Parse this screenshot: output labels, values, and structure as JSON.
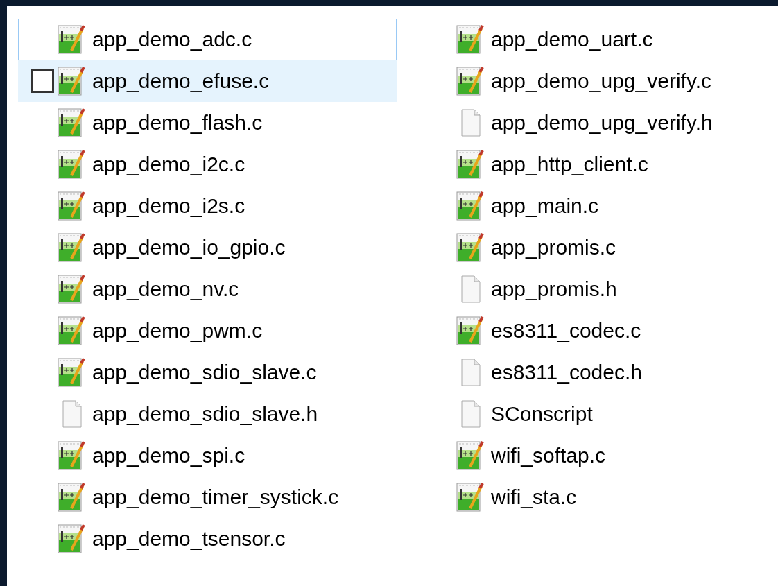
{
  "columns": [
    {
      "files": [
        {
          "name": "app_demo_adc.c",
          "kind": "source",
          "focused": true,
          "hovered": false
        },
        {
          "name": "app_demo_efuse.c",
          "kind": "source",
          "focused": false,
          "hovered": true
        },
        {
          "name": "app_demo_flash.c",
          "kind": "source",
          "focused": false,
          "hovered": false
        },
        {
          "name": "app_demo_i2c.c",
          "kind": "source",
          "focused": false,
          "hovered": false
        },
        {
          "name": "app_demo_i2s.c",
          "kind": "source",
          "focused": false,
          "hovered": false
        },
        {
          "name": "app_demo_io_gpio.c",
          "kind": "source",
          "focused": false,
          "hovered": false
        },
        {
          "name": "app_demo_nv.c",
          "kind": "source",
          "focused": false,
          "hovered": false
        },
        {
          "name": "app_demo_pwm.c",
          "kind": "source",
          "focused": false,
          "hovered": false
        },
        {
          "name": "app_demo_sdio_slave.c",
          "kind": "source",
          "focused": false,
          "hovered": false
        },
        {
          "name": "app_demo_sdio_slave.h",
          "kind": "blank",
          "focused": false,
          "hovered": false
        },
        {
          "name": "app_demo_spi.c",
          "kind": "source",
          "focused": false,
          "hovered": false
        },
        {
          "name": "app_demo_timer_systick.c",
          "kind": "source",
          "focused": false,
          "hovered": false
        },
        {
          "name": "app_demo_tsensor.c",
          "kind": "source",
          "focused": false,
          "hovered": false
        }
      ]
    },
    {
      "files": [
        {
          "name": "app_demo_uart.c",
          "kind": "source",
          "focused": false,
          "hovered": false
        },
        {
          "name": "app_demo_upg_verify.c",
          "kind": "source",
          "focused": false,
          "hovered": false
        },
        {
          "name": "app_demo_upg_verify.h",
          "kind": "blank",
          "focused": false,
          "hovered": false
        },
        {
          "name": "app_http_client.c",
          "kind": "source",
          "focused": false,
          "hovered": false
        },
        {
          "name": "app_main.c",
          "kind": "source",
          "focused": false,
          "hovered": false
        },
        {
          "name": "app_promis.c",
          "kind": "source",
          "focused": false,
          "hovered": false
        },
        {
          "name": "app_promis.h",
          "kind": "blank",
          "focused": false,
          "hovered": false
        },
        {
          "name": "es8311_codec.c",
          "kind": "source",
          "focused": false,
          "hovered": false
        },
        {
          "name": "es8311_codec.h",
          "kind": "blank",
          "focused": false,
          "hovered": false
        },
        {
          "name": "SConscript",
          "kind": "blank",
          "focused": false,
          "hovered": false
        },
        {
          "name": "wifi_softap.c",
          "kind": "source",
          "focused": false,
          "hovered": false
        },
        {
          "name": "wifi_sta.c",
          "kind": "source",
          "focused": false,
          "hovered": false
        }
      ]
    }
  ]
}
